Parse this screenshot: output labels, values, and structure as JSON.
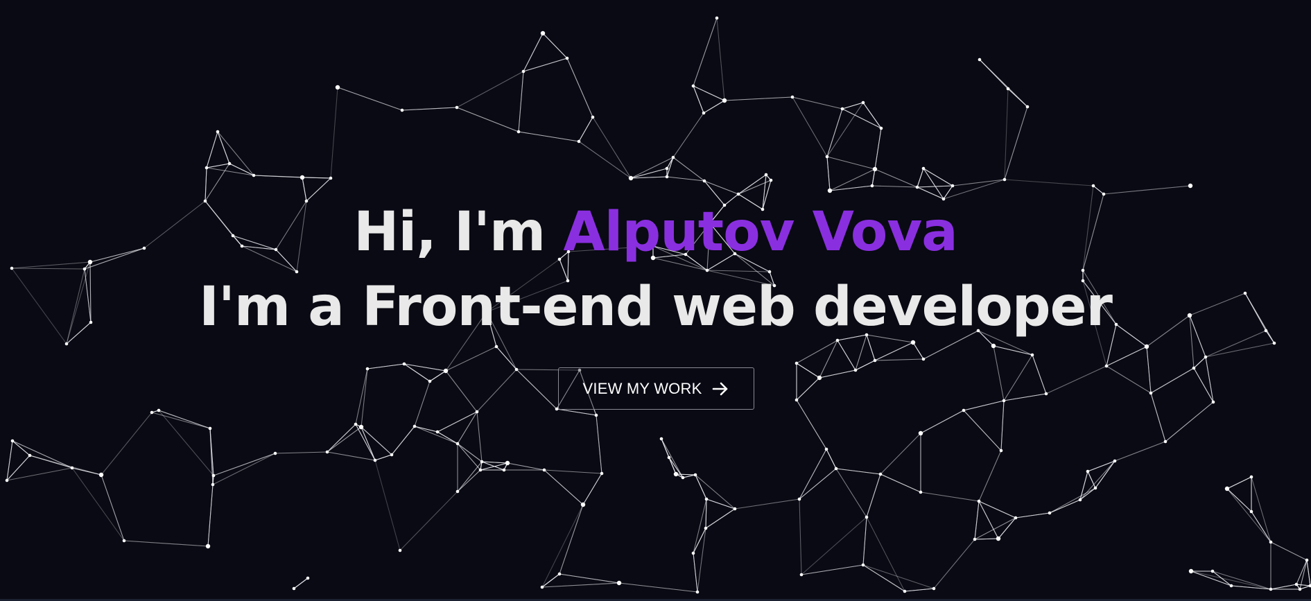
{
  "hero": {
    "greeting_prefix": "Hi, I'm ",
    "name": "Alputov Vova",
    "subtitle": "I'm a Front-end web developer",
    "cta_label": "VIEW MY WORK",
    "cta_icon": "arrow-right-icon"
  },
  "colors": {
    "background": "#090a13",
    "text": "#e9e9e9",
    "accent": "#8a2fe0",
    "network": "#e8e8ee"
  }
}
